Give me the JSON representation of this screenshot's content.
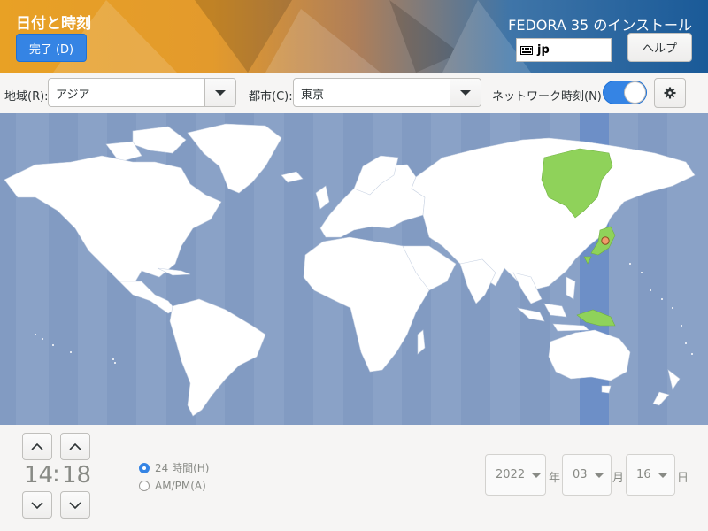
{
  "header": {
    "title": "日付と時刻",
    "done_label": "完了 (D)",
    "product": "FEDORA 35 のインストール",
    "keyboard_layout": "jp",
    "help_label": "ヘルプ"
  },
  "toolbar": {
    "region_label": "地域(R):",
    "region_value": "アジア",
    "city_label": "都市(C):",
    "city_value": "東京",
    "network_time_label": "ネットワーク時刻(N)",
    "network_time_on": true
  },
  "map": {
    "selected_timezone": "Asia/Tokyo",
    "highlight_color": "#6d8fc7",
    "land_color": "#ffffff",
    "ocean_color": "#8aa2c7",
    "selected_region_color": "#8fd25a"
  },
  "time": {
    "hours": "14",
    "separator": ":",
    "minutes": "18",
    "format_24h_label": "24 時間(H)",
    "format_ampm_label": "AM/PM(A)",
    "selected_format": "24h"
  },
  "date": {
    "year": "2022",
    "year_unit": "年",
    "month": "03",
    "month_unit": "月",
    "day": "16",
    "day_unit": "日"
  },
  "colors": {
    "accent": "#3584e4"
  }
}
